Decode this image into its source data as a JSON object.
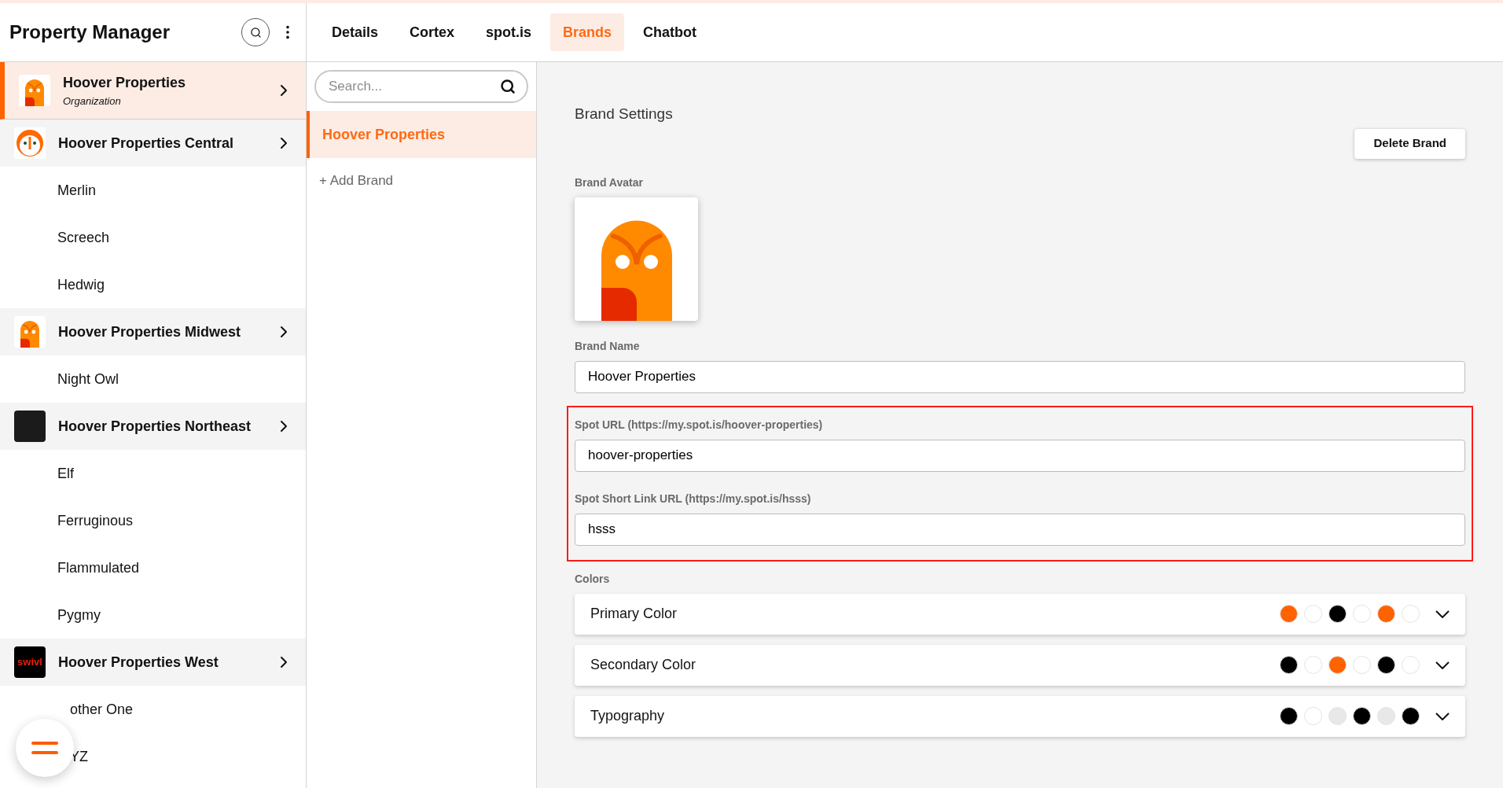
{
  "sidebar": {
    "title": "Property Manager",
    "groups": [
      {
        "name": "Hoover Properties",
        "subtitle": "Organization",
        "kind": "owl-body",
        "selected": true
      },
      {
        "name": "Hoover Properties Central",
        "kind": "owl-face",
        "selected": false,
        "items": [
          "Merlin",
          "Screech",
          "Hedwig"
        ]
      },
      {
        "name": "Hoover Properties Midwest",
        "kind": "owl-body",
        "selected": false,
        "items": [
          "Night Owl"
        ]
      },
      {
        "name": "Hoover Properties Northeast",
        "kind": "photo",
        "selected": false,
        "items": [
          "Elf",
          "Ferruginous",
          "Flammulated",
          "Pygmy"
        ]
      },
      {
        "name": "Hoover Properties West",
        "kind": "wordmark",
        "avatar_text": "swivl",
        "selected": false,
        "items": [
          "other One",
          "YZ"
        ]
      }
    ]
  },
  "tabs": [
    {
      "label": "Details",
      "selected": false
    },
    {
      "label": "Cortex",
      "selected": false
    },
    {
      "label": "spot.is",
      "selected": false
    },
    {
      "label": "Brands",
      "selected": true
    },
    {
      "label": "Chatbot",
      "selected": false
    }
  ],
  "brands": {
    "search_placeholder": "Search...",
    "items": [
      {
        "label": "Hoover Properties",
        "selected": true
      }
    ],
    "add_label": "+ Add Brand"
  },
  "settings": {
    "title": "Brand Settings",
    "delete_button": "Delete Brand",
    "avatar_label": "Brand Avatar",
    "fields": [
      {
        "label": "Brand Name",
        "value": "Hoover Properties",
        "highlighted": false
      },
      {
        "label": "Spot URL (https://my.spot.is/hoover-properties)",
        "value": "hoover-properties",
        "highlighted": true
      },
      {
        "label": "Spot Short Link URL (https://my.spot.is/hsss)",
        "value": "hsss",
        "highlighted": true
      }
    ],
    "colors_label": "Colors",
    "color_groups": [
      {
        "name": "Primary Color",
        "expanded": false,
        "swatches": [
          {
            "color": "#ff6200"
          },
          {
            "color": "#ffffff"
          },
          {
            "color": "#000000"
          },
          {
            "color": "#ffffff"
          },
          {
            "color": "#ff6200"
          },
          {
            "color": "#ffffff"
          }
        ]
      },
      {
        "name": "Secondary Color",
        "expanded": false,
        "swatches": [
          {
            "color": "#000000"
          },
          {
            "color": "#ffffff"
          },
          {
            "color": "#ff6200"
          },
          {
            "color": "#ffffff"
          },
          {
            "color": "#000000"
          },
          {
            "color": "#ffffff"
          }
        ]
      },
      {
        "name": "Typography",
        "expanded": false,
        "swatches": [
          {
            "color": "#000000"
          },
          {
            "color": "#ffffff"
          },
          {
            "color": "#e8e8e8"
          },
          {
            "color": "#000000"
          },
          {
            "color": "#e8e8e8"
          },
          {
            "color": "#000000"
          }
        ]
      }
    ]
  }
}
